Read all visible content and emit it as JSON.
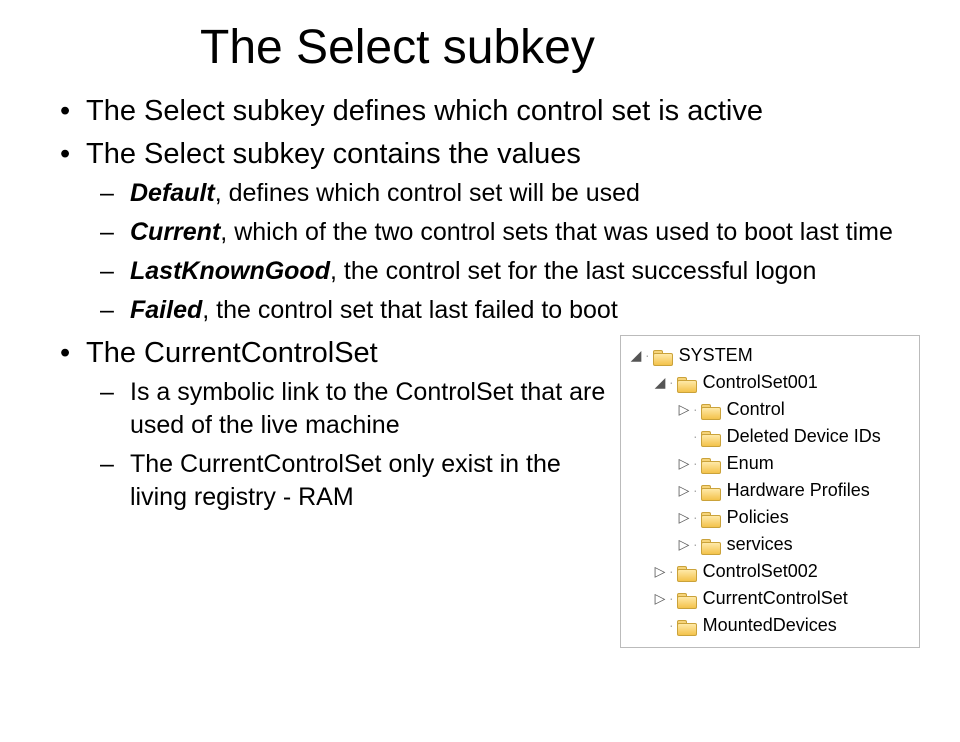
{
  "title": "The Select subkey",
  "bullets": {
    "b1": "The Select subkey defines which control set is active",
    "b2": "The Select subkey contains the values",
    "b2_subs": {
      "s1_term": "Default",
      "s1_rest": ", defines which control set will be used",
      "s2_term": "Current",
      "s2_rest": ", which of the two control sets that was used to boot last time",
      "s3_term": "LastKnownGood",
      "s3_rest": ", the control set for the last successful logon",
      "s4_term": "Failed",
      "s4_rest": ", the control set that last failed to boot"
    },
    "b3": "The CurrentControlSet",
    "b3_subs": {
      "s1": "Is a symbolic link to the ControlSet that are used of the live machine",
      "s2": "The CurrentControlSet only exist in the living registry - RAM"
    }
  },
  "tree": {
    "n0": "SYSTEM",
    "n1": "ControlSet001",
    "n2": "Control",
    "n3": "Deleted Device IDs",
    "n4": "Enum",
    "n5": "Hardware Profiles",
    "n6": "Policies",
    "n7": "services",
    "n8": "ControlSet002",
    "n9": "CurrentControlSet",
    "n10": "MountedDevices"
  },
  "twisty": {
    "open": "◢",
    "closed": "▷"
  }
}
